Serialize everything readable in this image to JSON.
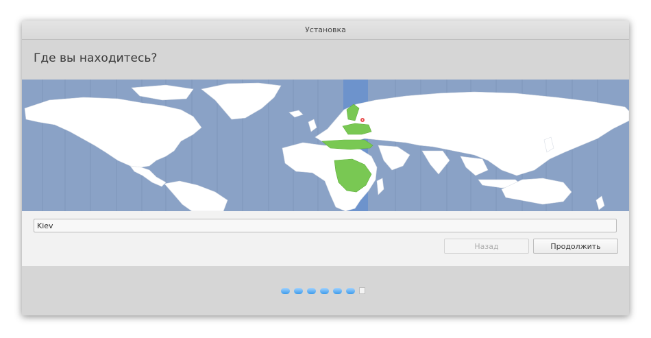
{
  "window": {
    "title": "Установка"
  },
  "page": {
    "heading": "Где вы находитесь?"
  },
  "timezone": {
    "value": "Kiev",
    "selected_zone_color": "#6d93cc",
    "highlight_color": "#79c853",
    "pin_color": "#e84d4d"
  },
  "buttons": {
    "back_label": "Назад",
    "continue_label": "Продолжить"
  },
  "progress": {
    "total_steps": 7,
    "current_step": 7,
    "completed_steps": 6
  }
}
